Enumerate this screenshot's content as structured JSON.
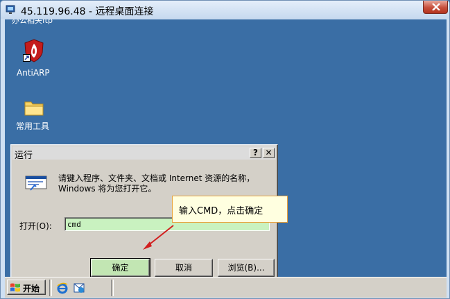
{
  "window": {
    "title": "45.119.96.48 - 远程桌面连接"
  },
  "desktop": {
    "cut_label": "办公相关ftp",
    "icons": [
      {
        "label": "AntiARP",
        "icon": "antiarp-shield-icon"
      },
      {
        "label": "常用工具",
        "icon": "folder-icon"
      }
    ]
  },
  "run_dialog": {
    "title": "运行",
    "help_label": "?",
    "close_label": "✕",
    "description": "请键入程序、文件夹、文档或 Internet 资源的名称，Windows 将为您打开它。",
    "open_label": "打开(O):",
    "open_value": "cmd",
    "buttons": {
      "ok": "确定",
      "cancel": "取消",
      "browse": "浏览(B)..."
    }
  },
  "annotation": {
    "text": "输入CMD，点击确定",
    "arrow_color": "#d21e1e"
  },
  "taskbar": {
    "start_label": "开始",
    "quick_launch": [
      "ie-icon",
      "outlook-express-icon"
    ]
  },
  "colors": {
    "desktop": "#3a6ea5",
    "input_highlight": "#c9f2c0",
    "callout_bg": "#ffffe0"
  }
}
